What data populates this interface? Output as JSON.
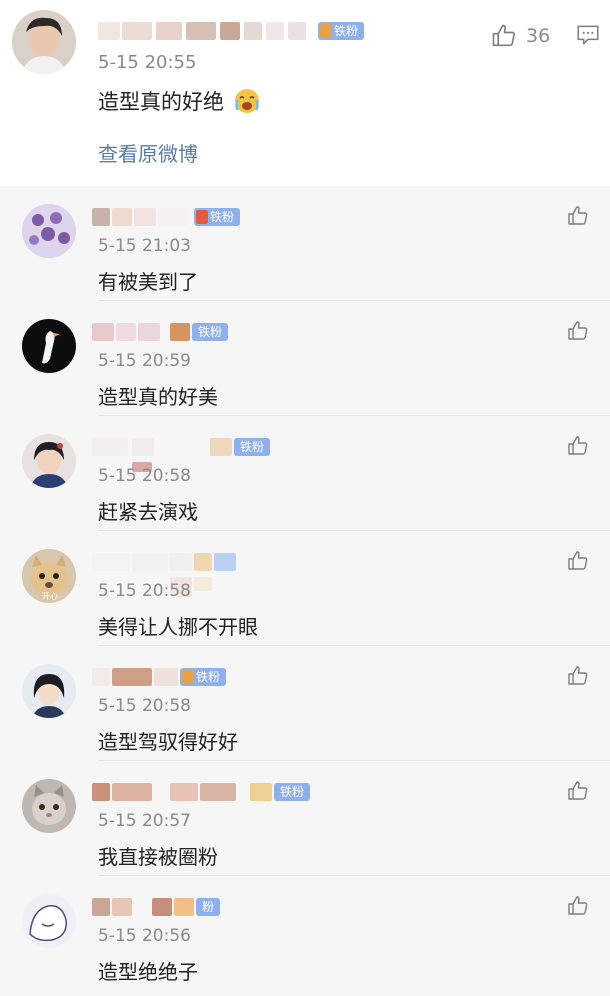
{
  "main_comment": {
    "time": "5-15 20:55",
    "text": "造型真的好绝",
    "badge": "铁粉",
    "like_count": "36",
    "view_original": "查看原微博"
  },
  "replies": [
    {
      "time": "5-15 21:03",
      "text": "有被美到了",
      "badge": "铁粉"
    },
    {
      "time": "5-15 20:59",
      "text": "造型真的好美",
      "badge": "铁粉"
    },
    {
      "time": "5-15 20:58",
      "text": "赶紧去演戏",
      "badge": "铁粉"
    },
    {
      "time": "5-15 20:58",
      "text": "美得让人挪不开眼",
      "badge": ""
    },
    {
      "time": "5-15 20:58",
      "text": "造型驾驭得好好",
      "badge": "铁粉"
    },
    {
      "time": "5-15 20:57",
      "text": "我直接被圈粉",
      "badge": "铁粉"
    },
    {
      "time": "5-15 20:56",
      "text": "造型绝绝子",
      "badge": "粉"
    }
  ],
  "avatar_texts": {
    "reply4": "开心"
  },
  "colors": {
    "link": "#5b7ba8",
    "badge": "#8fb0ef",
    "reply_bg": "#f6f6f6"
  },
  "icons": {
    "like": "thumbs-up-icon",
    "comment": "comment-icon"
  }
}
